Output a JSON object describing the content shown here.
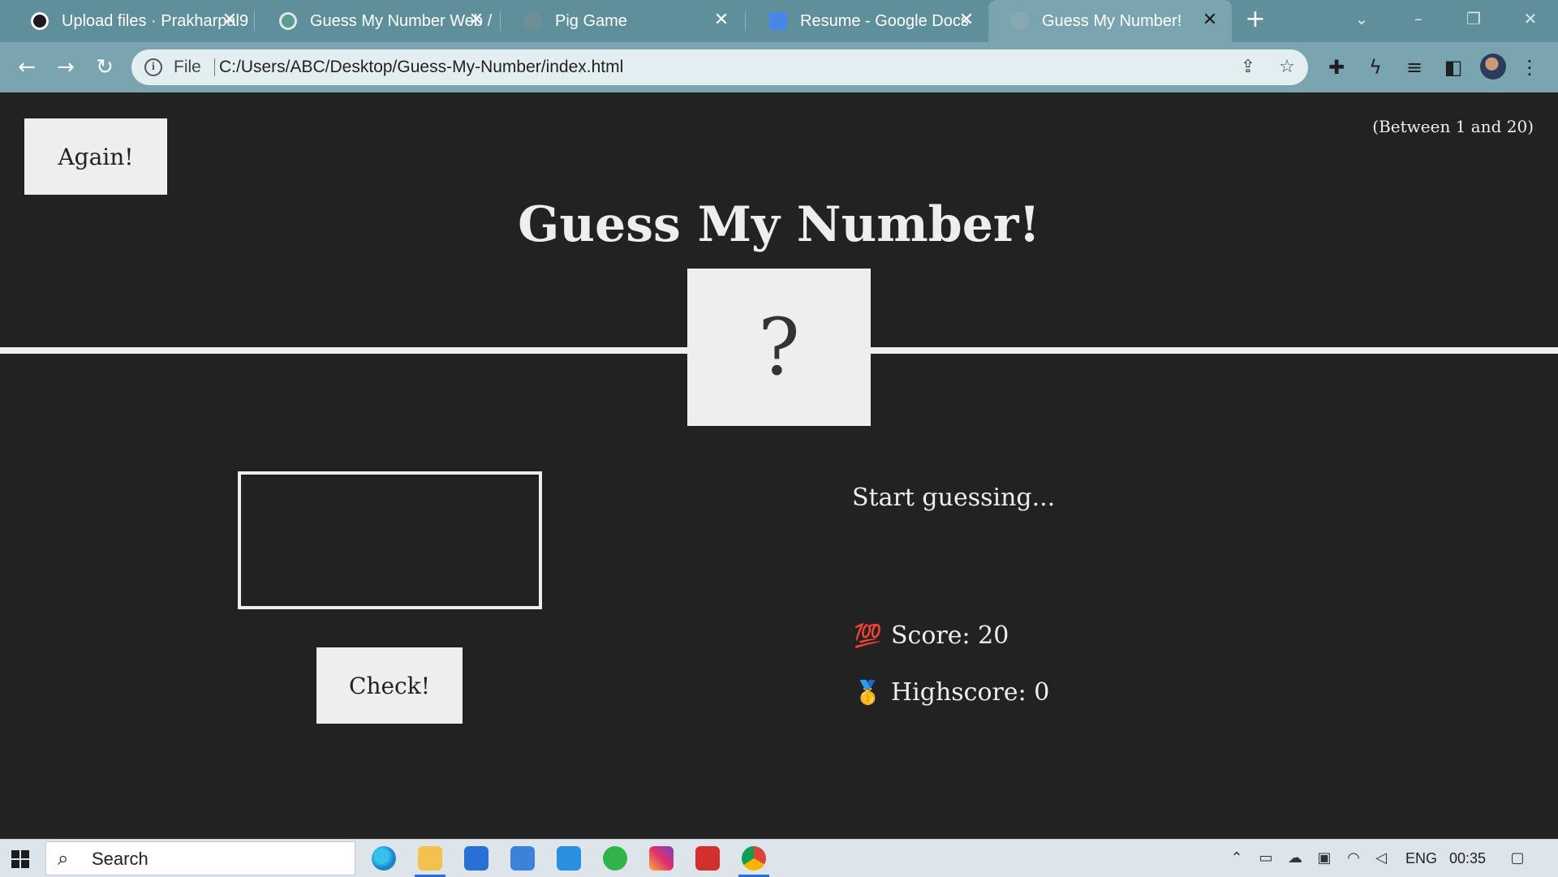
{
  "browser": {
    "tabs": [
      {
        "title": "Upload files · Prakharpal9",
        "icon": "github-icon"
      },
      {
        "title": "Guess My Number Web /",
        "icon": "chatgpt-icon"
      },
      {
        "title": "Pig Game",
        "icon": "globe-icon"
      },
      {
        "title": "Resume - Google Docs",
        "icon": "google-docs-icon"
      },
      {
        "title": "Guess My Number!",
        "icon": "globe-icon",
        "active": true
      }
    ],
    "address": {
      "scheme": "File",
      "url": "C:/Users/ABC/Desktop/Guess-My-Number/index.html"
    }
  },
  "game": {
    "again_label": "Again!",
    "range_hint": "(Between 1 and 20)",
    "title": "Guess My Number!",
    "secret": "?",
    "guess_value": "",
    "check_label": "Check!",
    "message": "Start guessing...",
    "score_emoji": "💯",
    "score_text": "Score: 20",
    "highscore_emoji": "🥇",
    "highscore_text": "Highscore: 0"
  },
  "taskbar": {
    "search_placeholder": "Search",
    "language": "ENG",
    "time": "00:35"
  },
  "colors": {
    "tabstrip": "#5f8f9b",
    "toolbar": "#7aa5b0",
    "page_bg": "#222222",
    "page_fg": "#eeeeee"
  }
}
